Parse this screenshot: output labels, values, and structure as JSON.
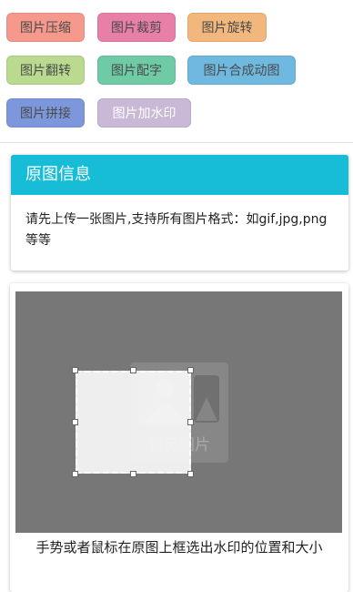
{
  "toolbar": {
    "buttons": [
      {
        "label": "图片压缩",
        "color": "#f5998c"
      },
      {
        "label": "图片裁剪",
        "color": "#e87fa6"
      },
      {
        "label": "图片旋转",
        "color": "#f2b77c"
      },
      {
        "label": "图片翻转",
        "color": "#b9da8f"
      },
      {
        "label": "图片配字",
        "color": "#6fcaa6"
      },
      {
        "label": "图片合成动图",
        "color": "#6fb8e0"
      },
      {
        "label": "图片拼接",
        "color": "#7d97dd"
      },
      {
        "label": "图片加水印",
        "color": "#c9b8d6"
      }
    ]
  },
  "info_panel": {
    "title": "原图信息",
    "header_color": "#17bcd6",
    "message": "请先上传一张图片,支持所有图片格式：如gif,jpg,png等等"
  },
  "editor": {
    "placeholder_text": "暂无图片",
    "canvas_color": "#777777",
    "caption": "手势或者鼠标在原图上框选出水印的位置和大小"
  },
  "icons": {
    "placeholder": "image-placeholder-icon",
    "crop_handles": "resize-handle-icon"
  }
}
